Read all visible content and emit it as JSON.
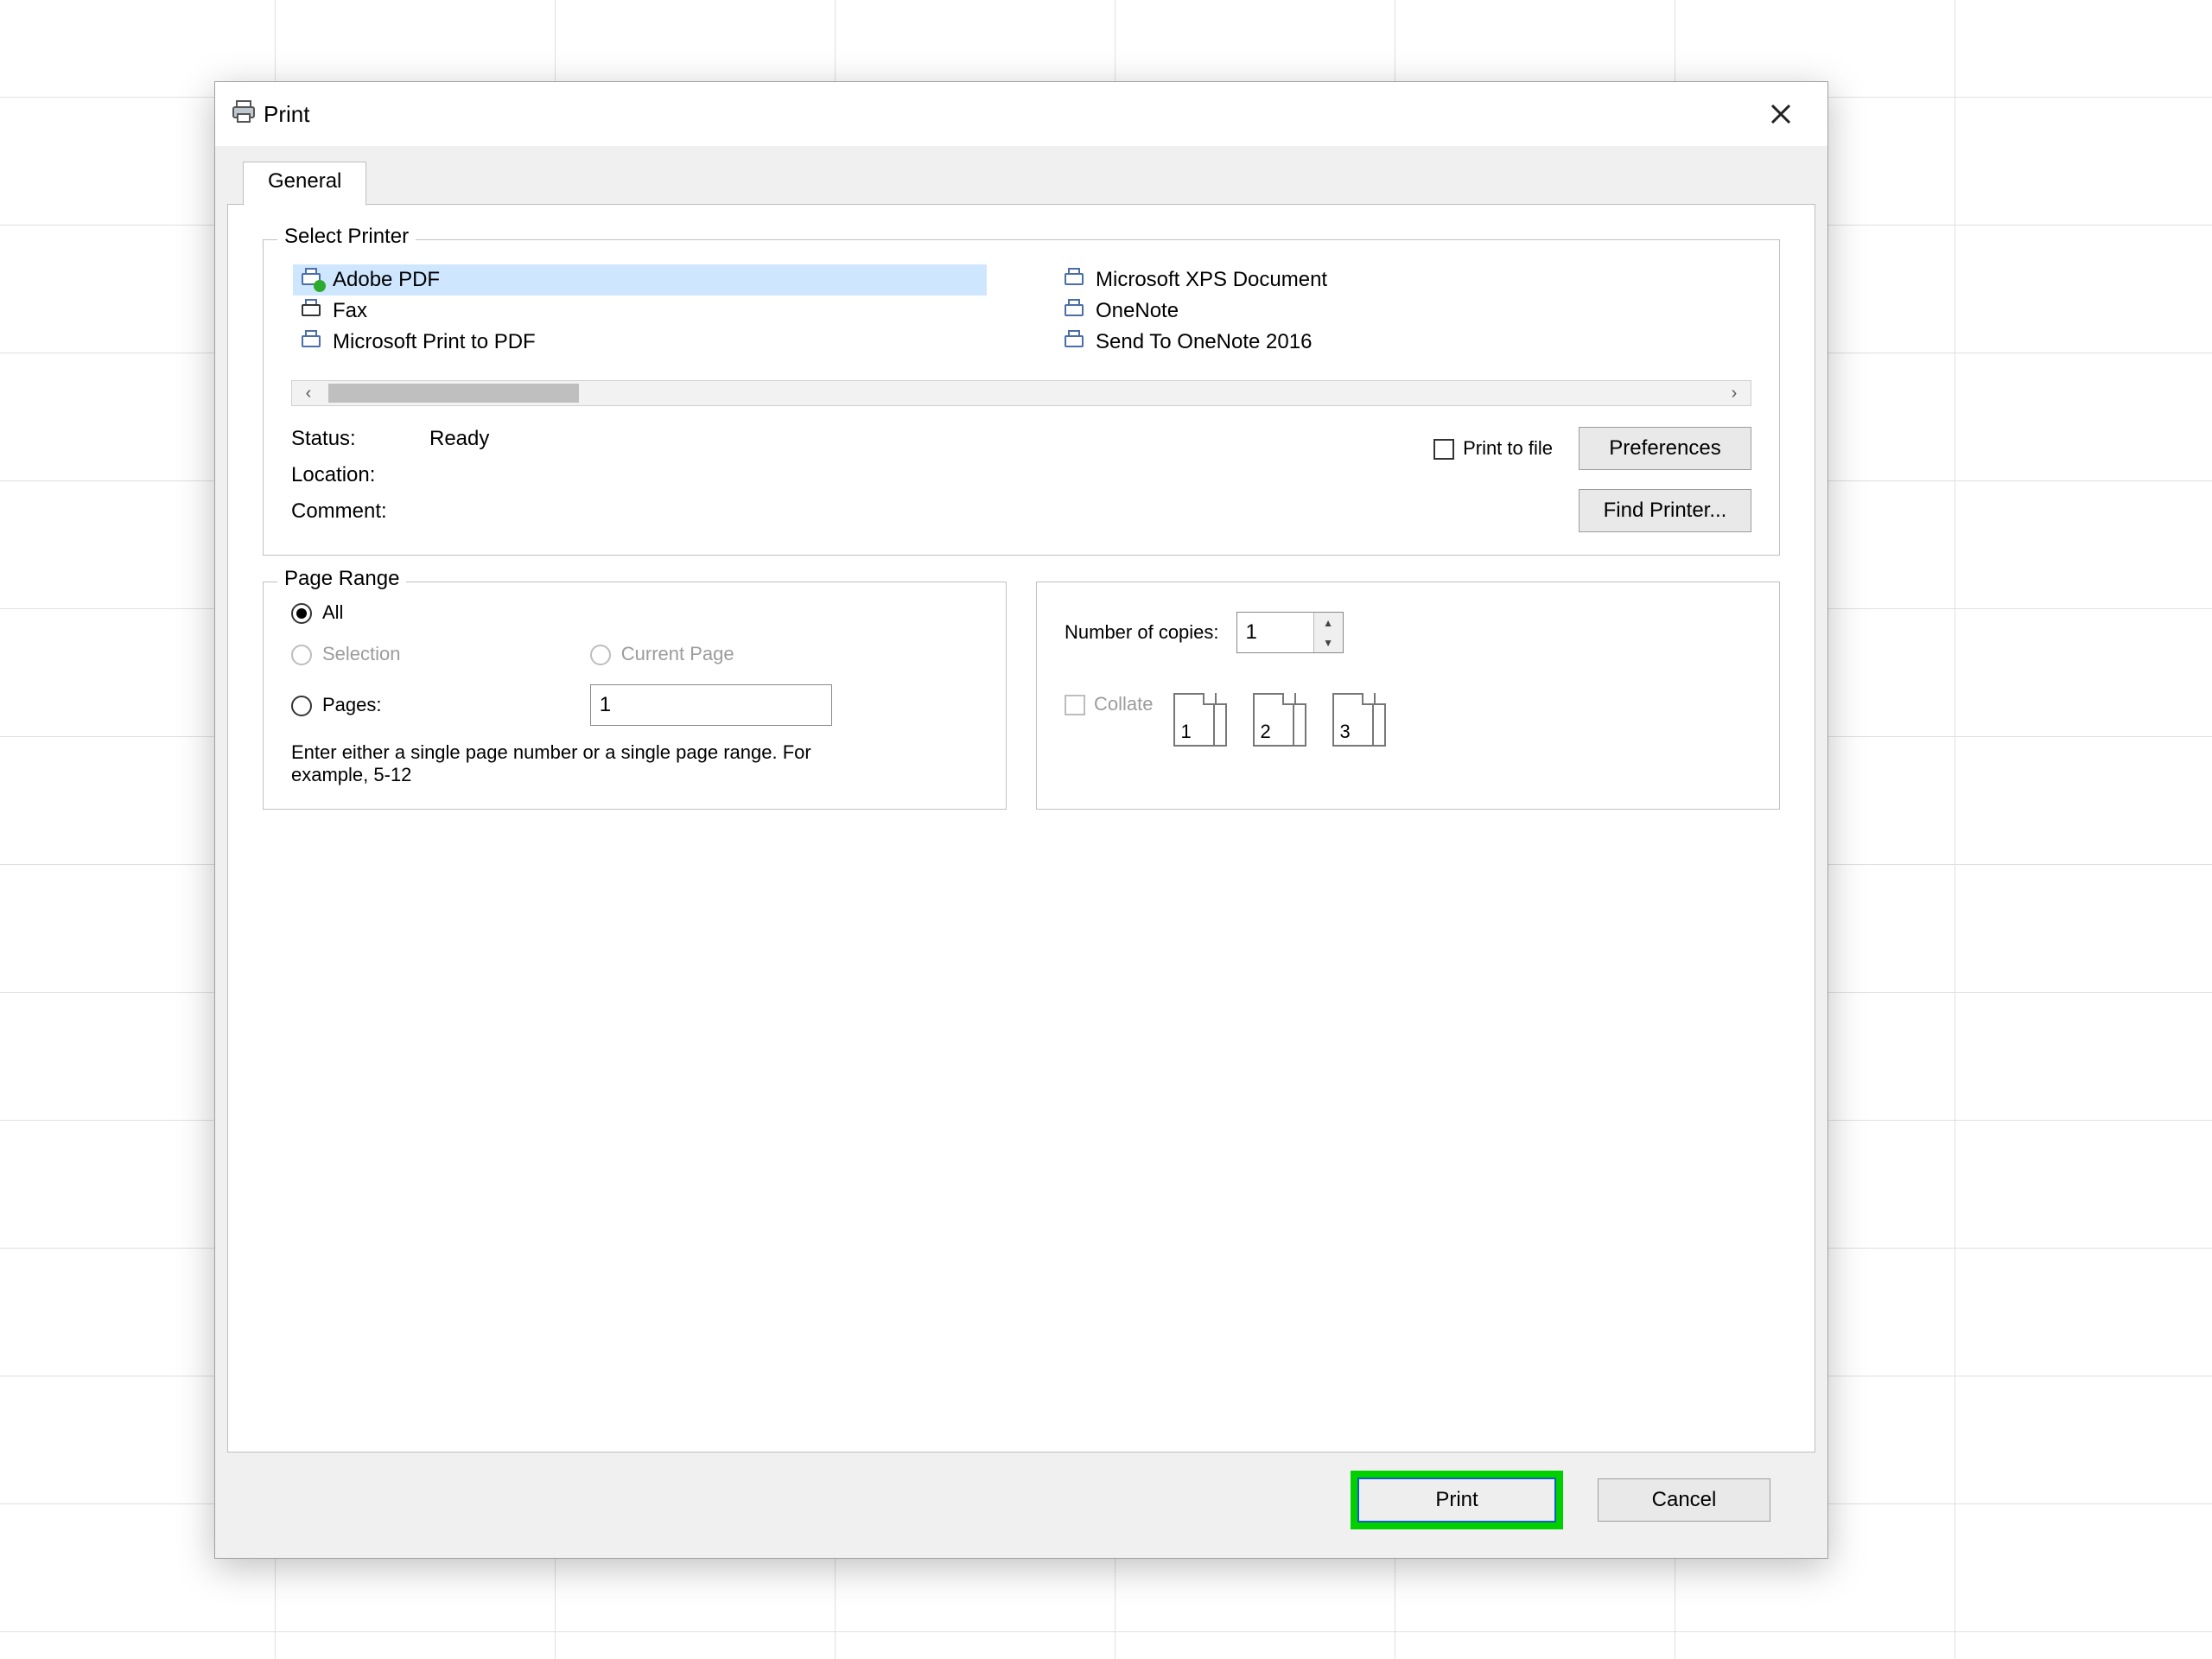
{
  "dialog": {
    "title": "Print",
    "tab_general": "General",
    "select_printer_legend": "Select Printer",
    "printers_left": [
      "Adobe PDF",
      "Fax",
      "Microsoft Print to PDF"
    ],
    "printers_right": [
      "Microsoft XPS Document",
      "OneNote",
      "Send To OneNote 2016"
    ],
    "selected_printer": "Adobe PDF",
    "status_label": "Status:",
    "status_value": "Ready",
    "location_label": "Location:",
    "comment_label": "Comment:",
    "print_to_file": "Print to file",
    "preferences_btn": "Preferences",
    "find_printer_btn": "Find Printer...",
    "page_range_legend": "Page Range",
    "radio_all": "All",
    "radio_selection": "Selection",
    "radio_current": "Current Page",
    "radio_pages": "Pages:",
    "pages_value": "1",
    "hint": "Enter either a single page number or a single page range.  For example, 5-12",
    "copies_label": "Number of copies:",
    "copies_value": "1",
    "collate_label": "Collate",
    "btn_print": "Print",
    "btn_cancel": "Cancel"
  }
}
